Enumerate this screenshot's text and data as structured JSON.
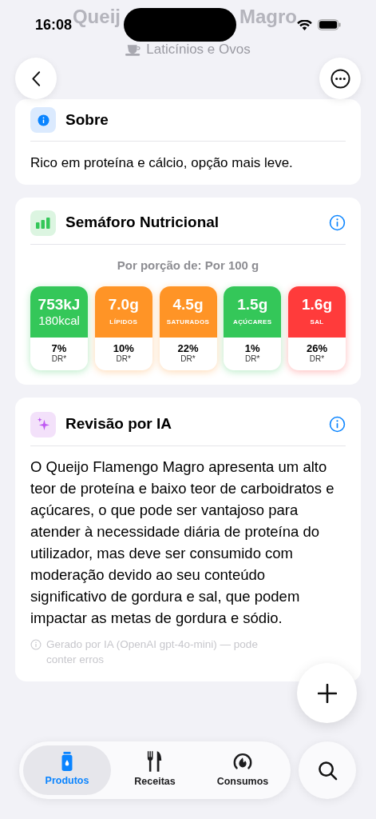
{
  "status_bar": {
    "time": "16:08"
  },
  "header": {
    "title_start": "Queij",
    "title_end": "Magro",
    "category": "Laticínios e Ovos"
  },
  "about": {
    "title": "Sobre",
    "text": "Rico em proteína e cálcio, opção mais leve."
  },
  "traffic_light": {
    "title": "Semáforo Nutricional",
    "portion": "Por porção de: Por 100 g",
    "items": [
      {
        "value": "753kJ",
        "label": "180kcal",
        "kind": "energy",
        "color": "#34c759",
        "percent": "7%",
        "dr": "DR*"
      },
      {
        "value": "7.0g",
        "label": "LÍPIDOS",
        "kind": "nutrient",
        "color": "#ff9426",
        "percent": "10%",
        "dr": "DR*"
      },
      {
        "value": "4.5g",
        "label": "SATURADOS",
        "kind": "nutrient",
        "color": "#ff9426",
        "percent": "22%",
        "dr": "DR*"
      },
      {
        "value": "1.5g",
        "label": "AÇÚCARES",
        "kind": "nutrient",
        "color": "#34c759",
        "percent": "1%",
        "dr": "DR*"
      },
      {
        "value": "1.6g",
        "label": "SAL",
        "kind": "nutrient",
        "color": "#ff3b3b",
        "percent": "26%",
        "dr": "DR*"
      }
    ]
  },
  "ai_review": {
    "title": "Revisão por IA",
    "text": "O Queijo Flamengo Magro apresenta um alto teor de proteína e baixo teor de carboidratos e açúcares, o que pode ser vantajoso para atender à necessidade diária de proteína do utilizador, mas deve ser consumido com moderação devido ao seu conteúdo significativo de gordura e sal, que podem impactar as metas de gordura e sódio.",
    "note": "Gerado por IA (OpenAI gpt-4o-mini) — pode conter erros"
  },
  "tab_bar": {
    "tabs": [
      {
        "label": "Produtos",
        "selected": true
      },
      {
        "label": "Receitas",
        "selected": false
      },
      {
        "label": "Consumos",
        "selected": false
      }
    ]
  }
}
